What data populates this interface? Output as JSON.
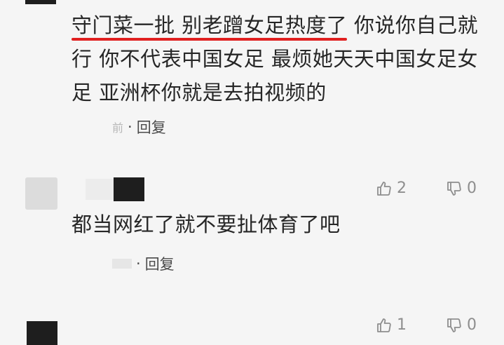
{
  "comment1": {
    "highlight_text": "守门菜一批 别老蹭女足热度了",
    "rest_text": " 你说你自己就行 你不代表中国女足 最烦她天天中国女足女足 亚洲杯你就是去拍视频的",
    "time": "前",
    "dot": "·",
    "reply_label": "回复",
    "like_count": "2",
    "dislike_count": "0"
  },
  "comment2": {
    "text": "都当网红了就不要扯体育了吧",
    "dot": "·",
    "reply_label": "回复",
    "like_count": "1",
    "dislike_count": "0"
  },
  "colors": {
    "highlight_underline": "#e02020",
    "background": "#f5f5f5",
    "icon": "#8e8e8e"
  },
  "icons": [
    "thumbs-up-icon",
    "thumbs-down-icon"
  ]
}
